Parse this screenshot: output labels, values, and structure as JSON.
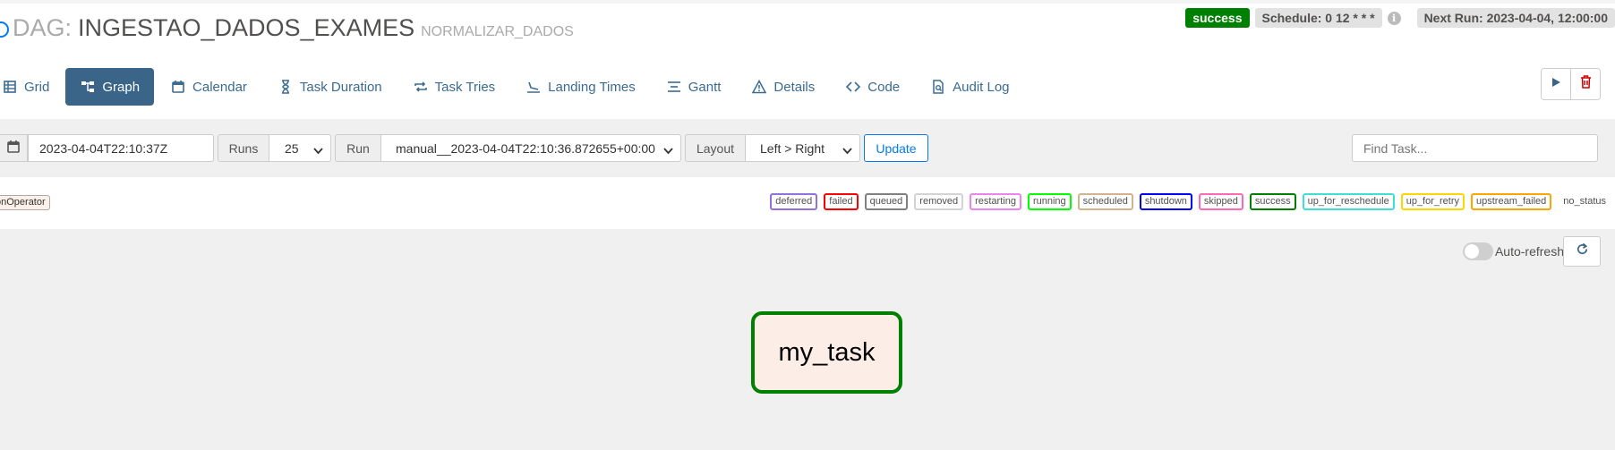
{
  "header": {
    "dag_prefix": "DAG:",
    "dag_id": "INGESTAO_DADOS_EXAMES",
    "dag_subtitle": "NORMALIZAR_DADOS",
    "state_badge": "success",
    "schedule": "Schedule: 0 12 * * *",
    "next_run": "Next Run: 2023-04-04, 12:00:00"
  },
  "tabs": [
    {
      "label": "Grid",
      "icon": "grid-icon",
      "active": false
    },
    {
      "label": "Graph",
      "icon": "graph-icon",
      "active": true
    },
    {
      "label": "Calendar",
      "icon": "calendar-icon",
      "active": false
    },
    {
      "label": "Task Duration",
      "icon": "hourglass-icon",
      "active": false
    },
    {
      "label": "Task Tries",
      "icon": "retry-icon",
      "active": false
    },
    {
      "label": "Landing Times",
      "icon": "landing-icon",
      "active": false
    },
    {
      "label": "Gantt",
      "icon": "gantt-icon",
      "active": false
    },
    {
      "label": "Details",
      "icon": "warning-triangle-icon",
      "active": false
    },
    {
      "label": "Code",
      "icon": "code-icon",
      "active": false
    },
    {
      "label": "Audit Log",
      "icon": "audit-log-icon",
      "active": false
    }
  ],
  "actions": {
    "trigger_icon": "play-icon",
    "delete_icon": "trash-icon"
  },
  "form": {
    "base_date": "2023-04-04T22:10:37Z",
    "runs_label": "Runs",
    "runs_value": "25",
    "run_label": "Run",
    "run_value": "manual__2023-04-04T22:10:36.872655+00:00",
    "layout_label": "Layout",
    "layout_value": "Left > Right",
    "update_label": "Update",
    "find_task_placeholder": "Find Task..."
  },
  "operator_legend": "onOperator",
  "status_legend": [
    {
      "label": "deferred",
      "color": "#9370db"
    },
    {
      "label": "failed",
      "color": "#ff0000"
    },
    {
      "label": "queued",
      "color": "#808080"
    },
    {
      "label": "removed",
      "color": "#d3d3d3"
    },
    {
      "label": "restarting",
      "color": "#ee82ee"
    },
    {
      "label": "running",
      "color": "#00ff00"
    },
    {
      "label": "scheduled",
      "color": "#d2b48c"
    },
    {
      "label": "shutdown",
      "color": "#0000ff"
    },
    {
      "label": "skipped",
      "color": "#ff69b4"
    },
    {
      "label": "success",
      "color": "#008000"
    },
    {
      "label": "up_for_reschedule",
      "color": "#40e0d0"
    },
    {
      "label": "up_for_retry",
      "color": "#ffd700"
    },
    {
      "label": "upstream_failed",
      "color": "#ffa500"
    },
    {
      "label": "no_status",
      "color": "#ffffff"
    }
  ],
  "graph": {
    "autorefresh_label": "Auto-refresh",
    "task": "my_task",
    "task_state_color": "#008000"
  },
  "colors": {
    "accent": "#017cee",
    "active_tab": "#3a6589",
    "success": "#008000",
    "danger": "#cc0000"
  }
}
